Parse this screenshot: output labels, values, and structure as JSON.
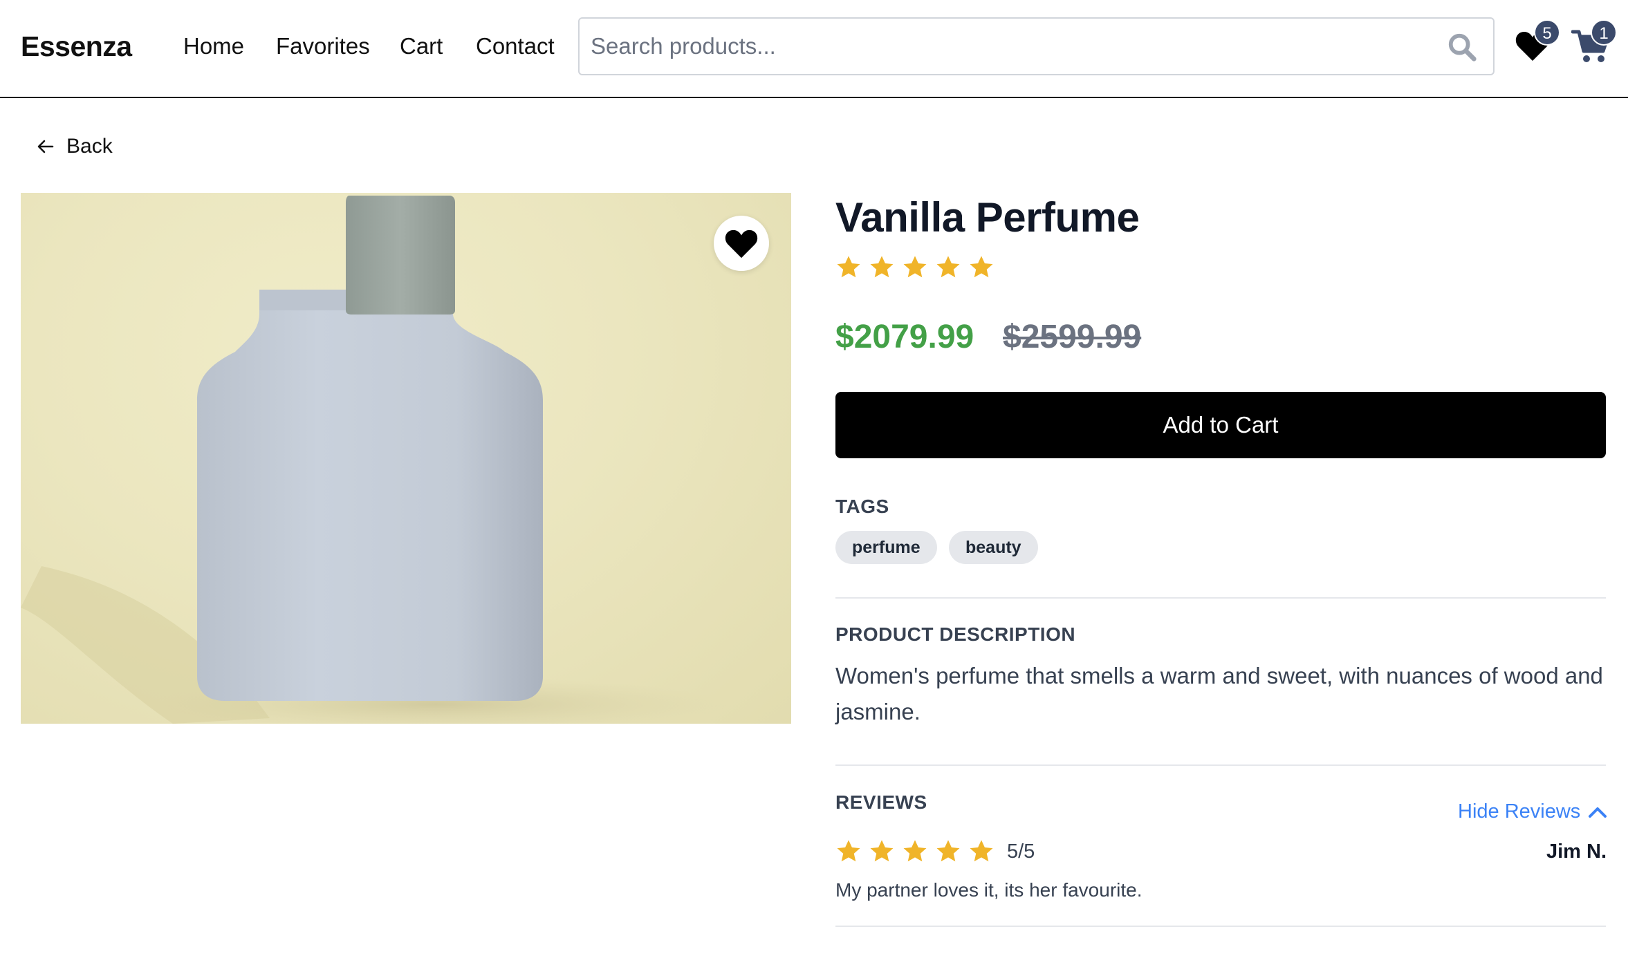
{
  "header": {
    "brand": "Essenza",
    "nav": [
      "Home",
      "Favorites",
      "Cart",
      "Contact"
    ],
    "search_placeholder": "Search products...",
    "favorites_count": "5",
    "cart_count": "1"
  },
  "back_label": "Back",
  "product": {
    "title": "Vanilla Perfume",
    "rating": 5,
    "price": "$2079.99",
    "old_price": "$2599.99",
    "add_to_cart": "Add to Cart",
    "tags_label": "TAGS",
    "tags": [
      "perfume",
      "beauty"
    ],
    "description_label": "PRODUCT DESCRIPTION",
    "description": "Women's perfume that smells a warm and sweet, with nuances of wood and jasmine."
  },
  "reviews": {
    "label": "REVIEWS",
    "toggle_label": "Hide Reviews",
    "items": [
      {
        "rating": 5,
        "score_text": "5/5",
        "author": "Jim N.",
        "text": "My partner loves it, its her favourite."
      }
    ]
  },
  "colors": {
    "star": "#f0b429",
    "price": "#43a047",
    "link": "#3b82f6",
    "badge": "#3b4a6b"
  }
}
